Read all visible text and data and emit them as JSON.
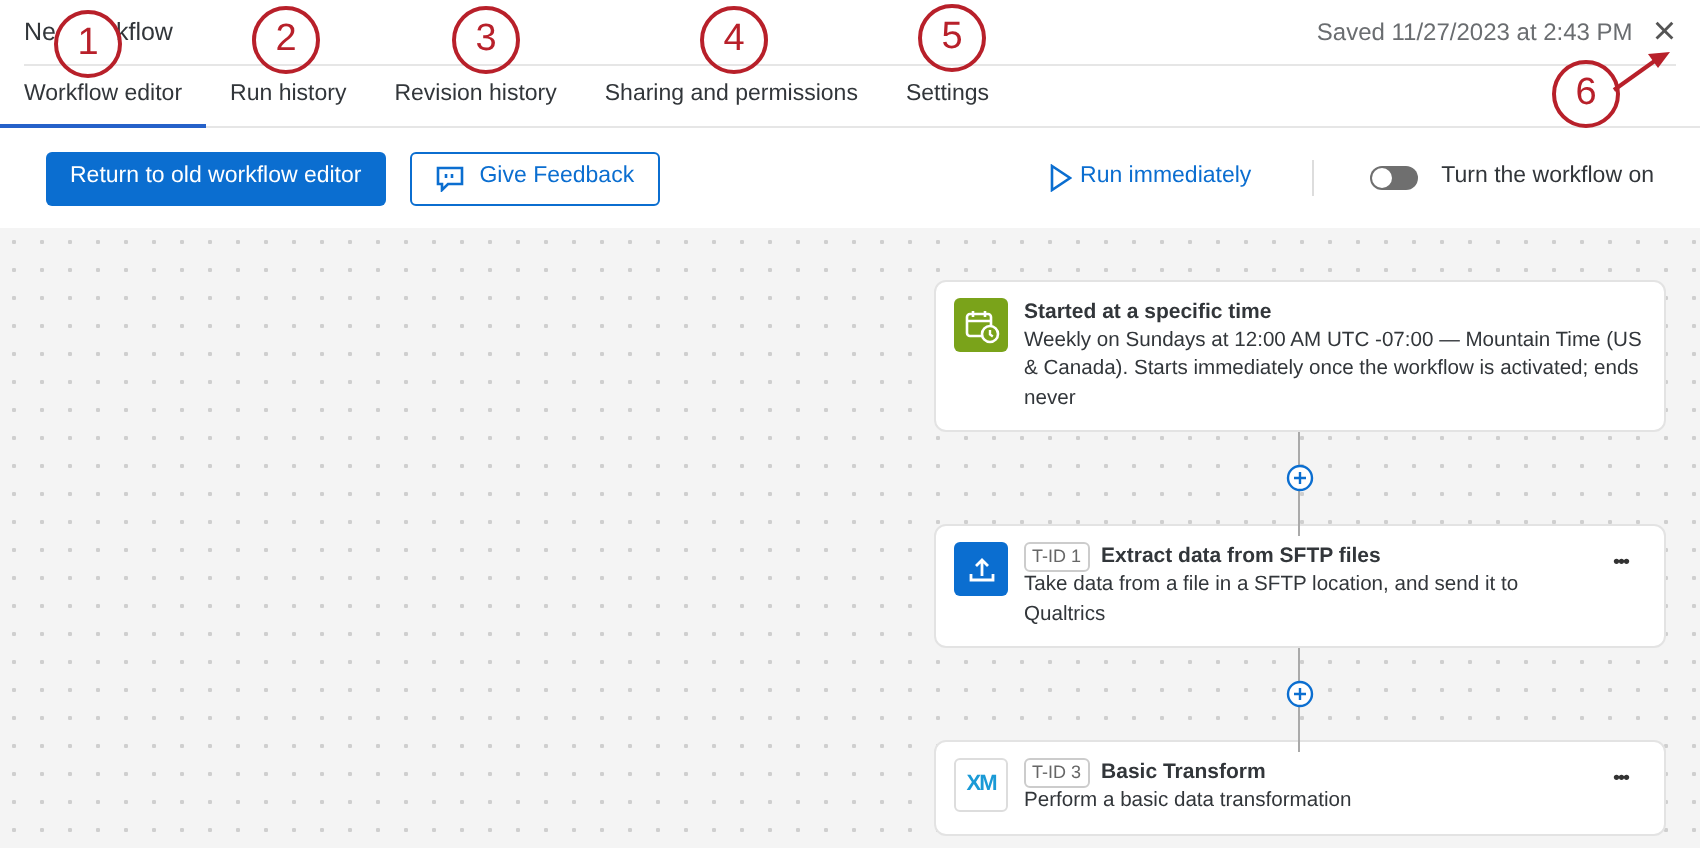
{
  "header": {
    "title_parts": [
      "Ne",
      "kflow"
    ],
    "saved": "Saved 11/27/2023 at 2:43 PM",
    "close": "×"
  },
  "tabs": [
    {
      "label": "Workflow editor",
      "selected": true
    },
    {
      "label": "Run history",
      "selected": false
    },
    {
      "label": "Revision history",
      "selected": false
    },
    {
      "label": "Sharing and permissions",
      "selected": false
    },
    {
      "label": "Settings",
      "selected": false
    }
  ],
  "toolbar": {
    "primary_button": "Return to old workflow editor",
    "feedback_button": "Give Feedback",
    "run_link": "Run immediately",
    "toggle": {
      "label": "Turn the workflow on",
      "on": false
    }
  },
  "steps": [
    {
      "kind": "trigger",
      "title": "Started at a specific time",
      "description": "Weekly on Sundays at 12:00 AM UTC -07:00 — Mountain Time (US & Canada). Starts immediately once the workflow is activated; ends never"
    },
    {
      "kind": "upload",
      "tag": "T-ID 1",
      "title": "Extract data from SFTP files",
      "description": "Take data from a file in a SFTP location, and send it to Qualtrics",
      "menu": "•••"
    },
    {
      "kind": "xm",
      "logo": "XM",
      "tag": "T-ID 3",
      "title": "Basic Transform",
      "description": "Perform a basic data transformation",
      "menu": "•••"
    }
  ],
  "callouts": [
    {
      "number": "1"
    },
    {
      "number": "2"
    },
    {
      "number": "3"
    },
    {
      "number": "4"
    },
    {
      "number": "5"
    },
    {
      "number": "6",
      "arrow": true
    }
  ]
}
